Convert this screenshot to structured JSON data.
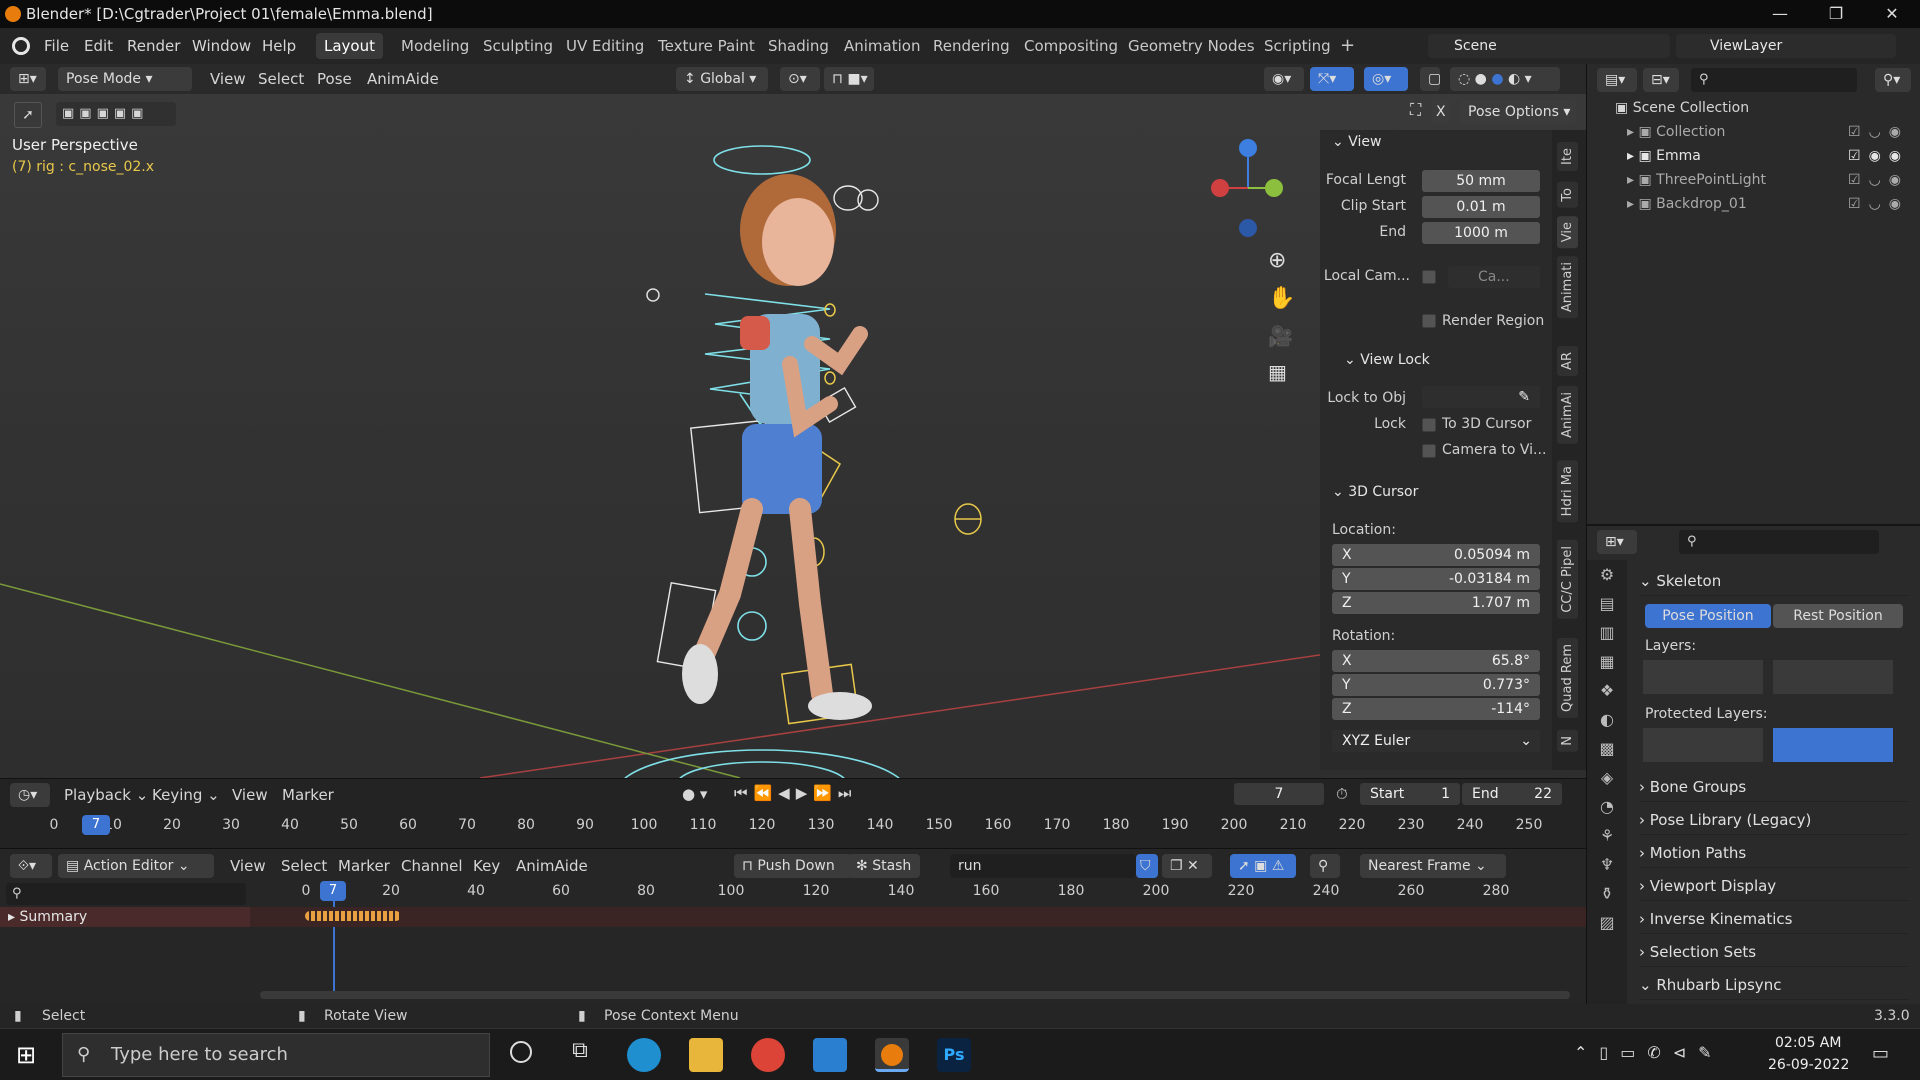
{
  "window": {
    "title": "Blender* [D:\\Cgtrader\\Project 01\\female\\Emma.blend]"
  },
  "menu": [
    "File",
    "Edit",
    "Render",
    "Window",
    "Help"
  ],
  "workspaces": [
    "Layout",
    "Modeling",
    "Sculpting",
    "UV Editing",
    "Texture Paint",
    "Shading",
    "Animation",
    "Rendering",
    "Compositing",
    "Geometry Nodes",
    "Scripting",
    "+"
  ],
  "scene": {
    "label": "Scene",
    "view_layer": "ViewLayer"
  },
  "viewport": {
    "mode": "Pose Mode",
    "menus": [
      "View",
      "Select",
      "Pose",
      "AnimAide"
    ],
    "orientation": "Global",
    "pose_options": "Pose Options",
    "perspective": "User Perspective",
    "active": "(7) rig : c_nose_02.x"
  },
  "npanel": {
    "view_header": "View",
    "focal_label": "Focal Lengt",
    "focal": "50 mm",
    "clip_start_label": "Clip Start",
    "clip_start": "0.01 m",
    "end_label": "End",
    "clip_end": "1000 m",
    "local_cam": "Local Cam...",
    "local_cam_value": "Ca...",
    "render_region": "Render Region",
    "view_lock": "View Lock",
    "lock_to_obj": "Lock to Obj",
    "lock": "Lock",
    "to_3d_cursor": "To 3D Cursor",
    "camera_to_view": "Camera to Vi...",
    "cursor_header": "3D Cursor",
    "location": "Location:",
    "loc": {
      "x": "0.05094 m",
      "y": "-0.03184 m",
      "z": "1.707 m"
    },
    "rotation": "Rotation:",
    "rot": {
      "x": "65.8°",
      "y": "0.773°",
      "z": "-114°"
    },
    "rot_mode": "XYZ Euler",
    "tabs": [
      "Ite",
      "To",
      "Vie",
      "Animati",
      "AR",
      "AnimAi",
      "Hdri Ma",
      "CC/C Pipel",
      "Quad Rem",
      "N"
    ]
  },
  "timeline": {
    "menus": [
      "Playback",
      "Keying",
      "View",
      "Marker"
    ],
    "frame": "7",
    "start_label": "Start",
    "start": "1",
    "end_label": "End",
    "end": "22",
    "ticks": [
      "0",
      "10",
      "20",
      "30",
      "40",
      "50",
      "60",
      "70",
      "80",
      "90",
      "100",
      "110",
      "120",
      "130",
      "140",
      "150",
      "160",
      "170",
      "180",
      "190",
      "200",
      "210",
      "220",
      "230",
      "240",
      "250"
    ],
    "cursor": "7"
  },
  "action_editor": {
    "type": "Action Editor",
    "menus": [
      "View",
      "Select",
      "Marker",
      "Channel",
      "Key",
      "AnimAide"
    ],
    "push_down": "Push Down",
    "stash": "Stash",
    "action": "run",
    "snap": "Nearest Frame",
    "summary": "Summary",
    "ticks": [
      "0",
      "20",
      "40",
      "60",
      "80",
      "100",
      "120",
      "140",
      "160",
      "180",
      "200",
      "220",
      "240",
      "260",
      "280"
    ],
    "cursor": "7"
  },
  "outliner": {
    "root": "Scene Collection",
    "items": [
      "Collection",
      "Emma",
      "ThreePointLight",
      "Backdrop_01"
    ]
  },
  "properties": {
    "skeleton": "Skeleton",
    "pose_position": "Pose Position",
    "rest_position": "Rest Position",
    "layers": "Layers:",
    "protected_layers": "Protected Layers:",
    "panels": [
      "Bone Groups",
      "Pose Library (Legacy)",
      "Motion Paths",
      "Viewport Display",
      "Inverse Kinematics",
      "Selection Sets",
      "Rhubarb Lipsync"
    ]
  },
  "status": {
    "select": "Select",
    "rotate": "Rotate View",
    "context": "Pose Context Menu",
    "version": "3.3.0"
  },
  "taskbar": {
    "search": "Type here to search",
    "time": "02:05 AM",
    "date": "26-09-2022"
  },
  "colors": {
    "accent": "#3e74d1",
    "active_ws": "#3a3a3a",
    "rig_cyan": "#7fe0e8",
    "rig_yellow": "#e8c84a"
  }
}
